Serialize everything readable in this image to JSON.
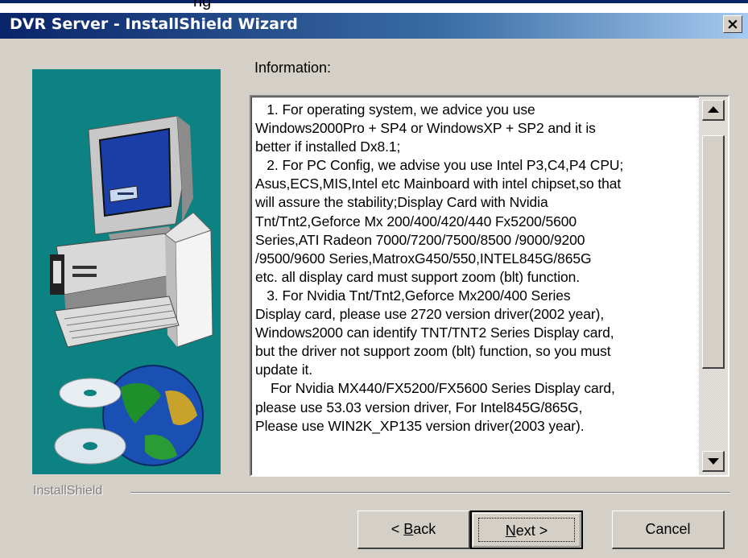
{
  "behind_window": {
    "partial_title": "ng"
  },
  "window": {
    "title": "DVR Server - InstallShield Wizard",
    "close_glyph": "×"
  },
  "illustration": {
    "icon": "computer-with-globe-and-cds-icon",
    "background_color": "#0c8282"
  },
  "info": {
    "label": "Information:",
    "lines": [
      "   1. For operating system, we advice you use",
      "Windows2000Pro + SP4 or WindowsXP + SP2 and it is",
      "better if installed Dx8.1;",
      "   2. For PC Config, we advise you use Intel P3,C4,P4 CPU;",
      "Asus,ECS,MIS,Intel etc Mainboard with intel chipset,so that",
      "will assure the stability;Display Card with Nvidia",
      "Tnt/Tnt2,Geforce Mx 200/400/420/440 Fx5200/5600",
      "Series,ATI Radeon 7000/7200/7500/8500 /9000/9200",
      "/9500/9600 Series,MatroxG450/550,INTEL845G/865G",
      "etc. all display card must support zoom (blt) function.",
      "   3. For Nvidia Tnt/Tnt2,Geforce Mx200/400 Series",
      "Display card, please use 2720 version driver(2002 year),",
      "Windows2000 can identify TNT/TNT2 Series Display card,",
      "but the driver not support zoom (blt) function, so you must",
      "update it.",
      "    For Nvidia MX440/FX5200/FX5600 Series Display card,",
      "please use 53.03 version driver, For Intel845G/865G,",
      "Please use WIN2K_XP135 version driver(2003 year)."
    ]
  },
  "scrollbar": {
    "up_icon": "scroll-up-arrow-icon",
    "down_icon": "scroll-down-arrow-icon"
  },
  "footer": {
    "brand": "InstallShield"
  },
  "buttons": {
    "back_prefix": "< ",
    "back_hotkey": "B",
    "back_rest": "ack",
    "next_hotkey": "N",
    "next_rest": "ext >",
    "cancel": "Cancel"
  }
}
